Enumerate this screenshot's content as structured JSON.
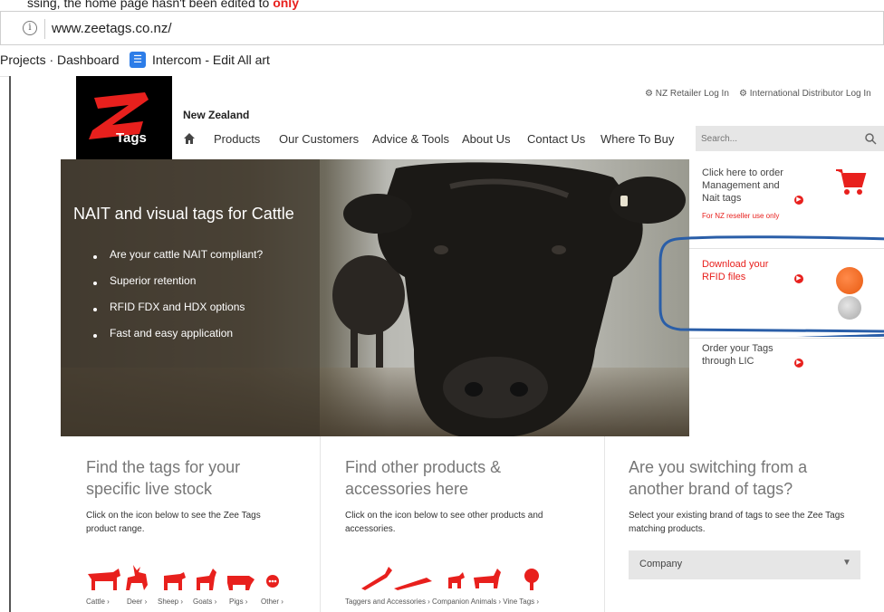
{
  "caption": {
    "text": "ssing, the home page hasn't been edited to ",
    "emphasis": "only"
  },
  "browser": {
    "url": "www.zeetags.co.nz/",
    "bookmarks": [
      {
        "label": "Projects · Dashboard"
      },
      {
        "label": "Intercom - Edit All art"
      }
    ]
  },
  "site": {
    "logo_text": "Tags",
    "region": "New Zealand",
    "top_links": {
      "retailer": "NZ Retailer Log In",
      "distributor": "International Distributor Log In"
    },
    "nav": [
      "Products",
      "Our Customers",
      "Advice & Tools",
      "About Us",
      "Contact Us",
      "Where To Buy"
    ],
    "search_placeholder": "Search..."
  },
  "hero": {
    "title": "NAIT and visual tags for Cattle",
    "bullets": [
      "Are your cattle NAIT compliant?",
      "Superior retention",
      "RFID FDX and HDX options",
      "Fast and easy application"
    ]
  },
  "side_panels": {
    "order": {
      "text_lines": [
        "Click here to order",
        "Management and",
        "Nait tags"
      ],
      "note": "For NZ reseller use only"
    },
    "rfid": {
      "text_lines": [
        "Download your",
        "RFID files"
      ]
    },
    "lic": {
      "text_lines": [
        "Order your Tags",
        "through LIC"
      ]
    }
  },
  "columns": {
    "livestock": {
      "title_lines": [
        "Find the tags for your",
        "specific live stock"
      ],
      "desc_lines": [
        "Click on the icon below to see the Zee Tags",
        "product range."
      ],
      "animals": [
        "Cattle ›",
        "Deer ›",
        "Sheep ›",
        "Goats ›",
        "Pigs ›",
        "Other ›"
      ]
    },
    "products": {
      "title_lines": [
        "Find other products &",
        "accessories here"
      ],
      "desc_lines": [
        "Click on the icon below to see other products and",
        "accessories."
      ],
      "links": "Taggers and Accessories › Companion Animals › Vine Tags ›"
    },
    "switch": {
      "title_lines": [
        "Are you switching from a",
        "another brand of tags?"
      ],
      "desc_lines": [
        "Select your existing brand of tags to see the Zee Tags",
        "matching products."
      ],
      "select_value": "Company"
    }
  },
  "colors": {
    "brand_red": "#e8201d",
    "annotation_blue": "#2a5ea8"
  }
}
